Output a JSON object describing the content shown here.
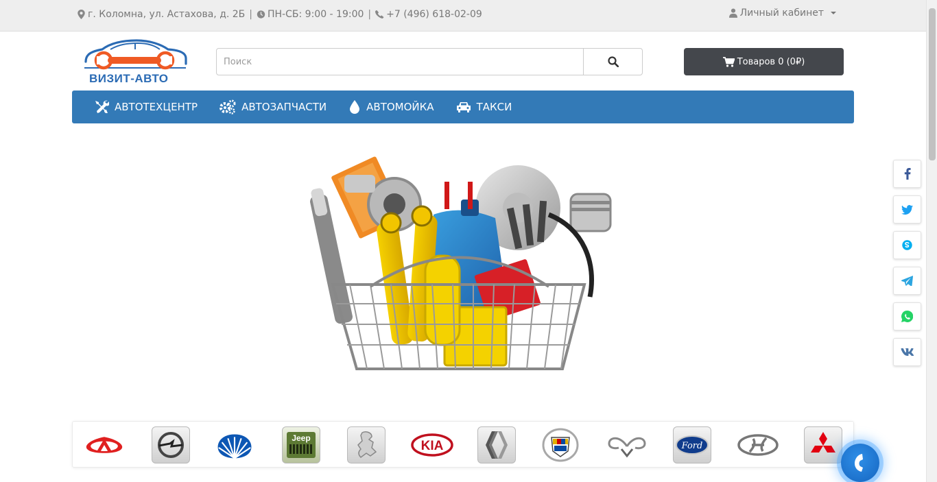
{
  "topbar": {
    "address": "г. Коломна, ул. Астахова, д. 2Б",
    "hours": "ПН-СБ: 9:00 - 19:00",
    "phone": "+7 (496) 618-02-09",
    "separator": "|",
    "account": "Личный кабинет"
  },
  "logo": {
    "text": "ВИЗИТ-АВТО"
  },
  "search": {
    "placeholder": "Поиск",
    "value": ""
  },
  "cart": {
    "label": "Товаров 0 (0₽)"
  },
  "nav": {
    "items": [
      {
        "label": "АВТОТЕХЦЕНТР",
        "icon": "wrench-screwdriver-icon"
      },
      {
        "label": "АВТОЗАПЧАСТИ",
        "icon": "gears-icon"
      },
      {
        "label": "АВТОМОЙКА",
        "icon": "droplet-icon"
      },
      {
        "label": "ТАКСИ",
        "icon": "car-icon"
      }
    ]
  },
  "hero": {
    "image": "basket-of-car-parts"
  },
  "social": [
    "facebook-icon",
    "twitter-icon",
    "skype-icon",
    "telegram-icon",
    "whatsapp-icon",
    "vk-icon"
  ],
  "brands": {
    "items": [
      {
        "name": "Chery",
        "icon": "chery-logo"
      },
      {
        "name": "Opel",
        "icon": "opel-logo"
      },
      {
        "name": "Daewoo",
        "icon": "daewoo-logo"
      },
      {
        "name": "Jeep",
        "icon": "jeep-logo",
        "text": "Jeep"
      },
      {
        "name": "Peugeot",
        "icon": "peugeot-logo"
      },
      {
        "name": "Kia",
        "icon": "kia-logo",
        "text": "KIA"
      },
      {
        "name": "Renault",
        "icon": "renault-logo"
      },
      {
        "name": "Cadillac",
        "icon": "cadillac-logo"
      },
      {
        "name": "SsangYong",
        "icon": "ssangyong-logo"
      },
      {
        "name": "Ford",
        "icon": "ford-logo",
        "text": "Ford"
      },
      {
        "name": "Hyundai",
        "icon": "hyundai-logo"
      },
      {
        "name": "Mitsubishi",
        "icon": "mitsubishi-logo"
      }
    ]
  },
  "colors": {
    "nav": "#337ab7",
    "cart": "#44474c",
    "logo_blue": "#2b6bb4",
    "logo_orange": "#ef5a24"
  }
}
